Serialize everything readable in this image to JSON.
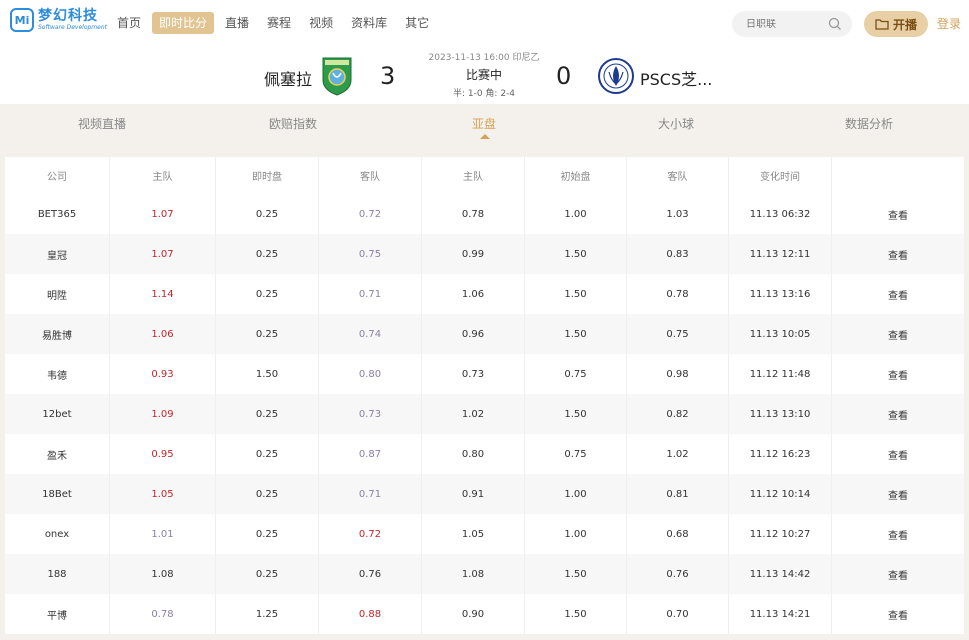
{
  "nav": {
    "logo_name": "梦幻科技",
    "logo_sub": "Software Development",
    "logo_mark": "Mi",
    "items": [
      "首页",
      "即时比分",
      "直播",
      "赛程",
      "视频",
      "资料库",
      "其它"
    ],
    "search_placeholder": "日职联",
    "live_label": "开播",
    "login_label": "登录"
  },
  "match": {
    "meta": "2023-11-13 16:00 印尼乙",
    "status": "比赛中",
    "sub": "半: 1-0  角: 2-4",
    "home_name": "佩塞拉",
    "home_score": "3",
    "away_score": "0",
    "away_name": "PSCS芝..."
  },
  "tabs": [
    "视频直播",
    "欧赔指数",
    "亚盘",
    "大小球",
    "数据分析"
  ],
  "table": {
    "headers": [
      "公司",
      "主队",
      "即时盘",
      "客队",
      "主队",
      "初始盘",
      "客队",
      "变化时间",
      ""
    ],
    "rows": [
      {
        "company": "BET365",
        "home": "1.07",
        "home_dir": "up",
        "line": "0.25",
        "away": "0.72",
        "away_dir": "down",
        "init_home": "0.78",
        "init_line": "1.00",
        "init_away": "1.03",
        "time": "11.13 06:32",
        "action": "查看"
      },
      {
        "company": "皇冠",
        "home": "1.07",
        "home_dir": "up",
        "line": "0.25",
        "away": "0.75",
        "away_dir": "down",
        "init_home": "0.99",
        "init_line": "1.50",
        "init_away": "0.83",
        "time": "11.13 12:11",
        "action": "查看"
      },
      {
        "company": "明陞",
        "home": "1.14",
        "home_dir": "up",
        "line": "0.25",
        "away": "0.71",
        "away_dir": "down",
        "init_home": "1.06",
        "init_line": "1.50",
        "init_away": "0.78",
        "time": "11.13 13:16",
        "action": "查看"
      },
      {
        "company": "易胜博",
        "home": "1.06",
        "home_dir": "up",
        "line": "0.25",
        "away": "0.74",
        "away_dir": "down",
        "init_home": "0.96",
        "init_line": "1.50",
        "init_away": "0.75",
        "time": "11.13 10:05",
        "action": "查看"
      },
      {
        "company": "韦德",
        "home": "0.93",
        "home_dir": "up",
        "line": "1.50",
        "away": "0.80",
        "away_dir": "down",
        "init_home": "0.73",
        "init_line": "0.75",
        "init_away": "0.98",
        "time": "11.12 11:48",
        "action": "查看"
      },
      {
        "company": "12bet",
        "home": "1.09",
        "home_dir": "up",
        "line": "0.25",
        "away": "0.73",
        "away_dir": "down",
        "init_home": "1.02",
        "init_line": "1.50",
        "init_away": "0.82",
        "time": "11.13 13:10",
        "action": "查看"
      },
      {
        "company": "盈禾",
        "home": "0.95",
        "home_dir": "up",
        "line": "0.25",
        "away": "0.87",
        "away_dir": "down",
        "init_home": "0.80",
        "init_line": "0.75",
        "init_away": "1.02",
        "time": "11.12 16:23",
        "action": "查看"
      },
      {
        "company": "18Bet",
        "home": "1.05",
        "home_dir": "up",
        "line": "0.25",
        "away": "0.71",
        "away_dir": "down",
        "init_home": "0.91",
        "init_line": "1.00",
        "init_away": "0.81",
        "time": "11.12 10:14",
        "action": "查看"
      },
      {
        "company": "onex",
        "home": "1.01",
        "home_dir": "down",
        "line": "0.25",
        "away": "0.72",
        "away_dir": "up",
        "init_home": "1.05",
        "init_line": "1.00",
        "init_away": "0.68",
        "time": "11.12 10:27",
        "action": "查看"
      },
      {
        "company": "188",
        "home": "1.08",
        "home_dir": "same",
        "line": "0.25",
        "away": "0.76",
        "away_dir": "same",
        "init_home": "1.08",
        "init_line": "1.50",
        "init_away": "0.76",
        "time": "11.13 14:42",
        "action": "查看"
      },
      {
        "company": "平博",
        "home": "0.78",
        "home_dir": "down",
        "line": "1.25",
        "away": "0.88",
        "away_dir": "up",
        "init_home": "0.90",
        "init_line": "1.50",
        "init_away": "0.70",
        "time": "11.13 14:21",
        "action": "查看"
      }
    ]
  },
  "colors": {
    "accent": "#d4a35a",
    "nav_active_bg": "#e2c493",
    "up": "#c0262b",
    "down": "#8a7fa8"
  }
}
